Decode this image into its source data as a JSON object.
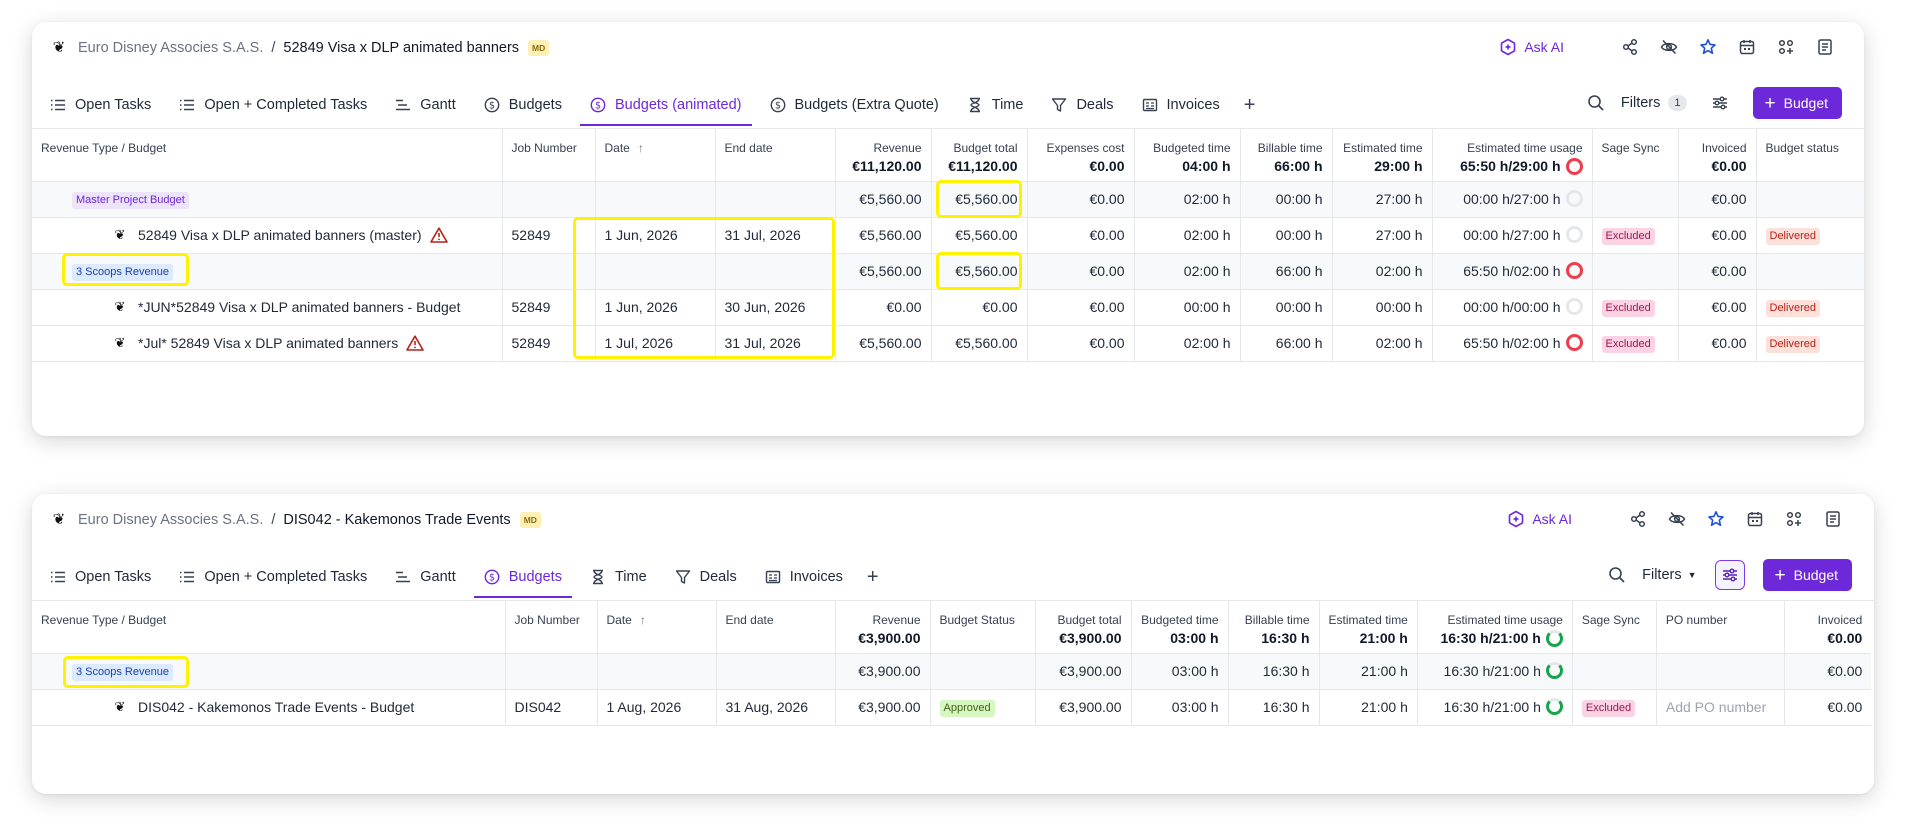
{
  "panel1": {
    "breadcrumb": {
      "client": "Euro Disney Associes S.A.S.",
      "separator": "/",
      "project": "52849 Visa x DLP animated banners",
      "badge": "MD"
    },
    "actions": {
      "ask_ai": "Ask AI",
      "icons": [
        "share-icon",
        "eye-off-icon",
        "star-icon",
        "calendar-icon",
        "apps-icon",
        "document-icon"
      ]
    },
    "tabs": [
      {
        "label": "Open Tasks",
        "icon": "list-icon",
        "active": false
      },
      {
        "label": "Open + Completed Tasks",
        "icon": "list-icon",
        "active": false
      },
      {
        "label": "Gantt",
        "icon": "gantt-icon",
        "active": false
      },
      {
        "label": "Budgets",
        "icon": "dollar-icon",
        "active": false
      },
      {
        "label": "Budgets (animated)",
        "icon": "dollar-icon",
        "active": true
      },
      {
        "label": "Budgets (Extra Quote)",
        "icon": "dollar-icon",
        "active": false
      },
      {
        "label": "Time",
        "icon": "hourglass-icon",
        "active": false
      },
      {
        "label": "Deals",
        "icon": "funnel-icon",
        "active": false
      },
      {
        "label": "Invoices",
        "icon": "invoice-icon",
        "active": false
      }
    ],
    "tools": {
      "filters_label": "Filters",
      "filters_count": "1",
      "budget_button": "Budget"
    },
    "columns": [
      {
        "label": "Revenue Type / Budget",
        "total": ""
      },
      {
        "label": "Job Number",
        "total": ""
      },
      {
        "label": "Date",
        "total": ""
      },
      {
        "label": "End date",
        "total": ""
      },
      {
        "label": "Revenue",
        "total": "€11,120.00"
      },
      {
        "label": "Budget total",
        "total": "€11,120.00"
      },
      {
        "label": "Expenses cost",
        "total": "€0.00"
      },
      {
        "label": "Budgeted time",
        "total": "04:00 h"
      },
      {
        "label": "Billable time",
        "total": "66:00 h"
      },
      {
        "label": "Estimated time",
        "total": "29:00 h"
      },
      {
        "label": "Estimated time usage",
        "total": "65:50 h/29:00 h"
      },
      {
        "label": "Sage Sync",
        "total": ""
      },
      {
        "label": "Invoiced",
        "total": "€0.00"
      },
      {
        "label": "Budget status",
        "total": ""
      }
    ],
    "header_ring": "red",
    "rows": [
      {
        "kind": "group",
        "name": "Master Project Budget",
        "pill": "purple",
        "job": "",
        "date": "",
        "end": "",
        "revenue": "€5,560.00",
        "budget_total": "€5,560.00",
        "expenses": "€0.00",
        "budgeted": "02:00 h",
        "billable": "00:00 h",
        "estimated": "27:00 h",
        "usage": "00:00 h/27:00 h",
        "ring": "grey",
        "sage": "",
        "invoiced": "€0.00",
        "status": ""
      },
      {
        "kind": "item",
        "name": "52849 Visa x DLP animated banners (master)",
        "warn": true,
        "job": "52849",
        "date": "1 Jun, 2026",
        "end": "31 Jul, 2026",
        "revenue": "€5,560.00",
        "budget_total": "€5,560.00",
        "expenses": "€0.00",
        "budgeted": "02:00 h",
        "billable": "00:00 h",
        "estimated": "27:00 h",
        "usage": "00:00 h/27:00 h",
        "ring": "grey",
        "sage": "Excluded",
        "invoiced": "€0.00",
        "status": "Delivered"
      },
      {
        "kind": "group",
        "name": "3 Scoops Revenue",
        "pill": "blue",
        "job": "",
        "date": "",
        "end": "",
        "revenue": "€5,560.00",
        "budget_total": "€5,560.00",
        "expenses": "€0.00",
        "budgeted": "02:00 h",
        "billable": "66:00 h",
        "estimated": "02:00 h",
        "usage": "65:50 h/02:00 h",
        "ring": "red",
        "sage": "",
        "invoiced": "€0.00",
        "status": ""
      },
      {
        "kind": "item",
        "name": "*JUN*52849 Visa x DLP animated banners - Budget",
        "warn": false,
        "job": "52849",
        "date": "1 Jun, 2026",
        "end": "30 Jun, 2026",
        "revenue": "€0.00",
        "budget_total": "€0.00",
        "expenses": "€0.00",
        "budgeted": "00:00 h",
        "billable": "00:00 h",
        "estimated": "00:00 h",
        "usage": "00:00 h/00:00 h",
        "ring": "grey",
        "sage": "Excluded",
        "invoiced": "€0.00",
        "status": "Delivered"
      },
      {
        "kind": "item",
        "name": "*Jul* 52849 Visa x DLP animated banners",
        "warn": true,
        "job": "52849",
        "date": "1 Jul, 2026",
        "end": "31 Jul, 2026",
        "revenue": "€5,560.00",
        "budget_total": "€5,560.00",
        "expenses": "€0.00",
        "budgeted": "02:00 h",
        "billable": "66:00 h",
        "estimated": "02:00 h",
        "usage": "65:50 h/02:00 h",
        "ring": "red",
        "sage": "Excluded",
        "invoiced": "€0.00",
        "status": "Delivered"
      }
    ]
  },
  "panel2": {
    "breadcrumb": {
      "client": "Euro Disney Associes S.A.S.",
      "separator": "/",
      "project": "DIS042 - Kakemonos Trade Events",
      "badge": "MD"
    },
    "actions": {
      "ask_ai": "Ask AI",
      "icons": [
        "share-icon",
        "eye-off-icon",
        "star-icon",
        "calendar-icon",
        "apps-icon",
        "document-icon"
      ]
    },
    "tabs": [
      {
        "label": "Open Tasks",
        "icon": "list-icon",
        "active": false
      },
      {
        "label": "Open + Completed Tasks",
        "icon": "list-icon",
        "active": false
      },
      {
        "label": "Gantt",
        "icon": "gantt-icon",
        "active": false
      },
      {
        "label": "Budgets",
        "icon": "dollar-icon",
        "active": true
      },
      {
        "label": "Time",
        "icon": "hourglass-icon",
        "active": false
      },
      {
        "label": "Deals",
        "icon": "funnel-icon",
        "active": false
      },
      {
        "label": "Invoices",
        "icon": "invoice-icon",
        "active": false
      }
    ],
    "tools": {
      "filters_label": "Filters",
      "budget_button": "Budget"
    },
    "columns": [
      {
        "label": "Revenue Type / Budget",
        "total": ""
      },
      {
        "label": "Job Number",
        "total": ""
      },
      {
        "label": "Date",
        "total": ""
      },
      {
        "label": "End date",
        "total": ""
      },
      {
        "label": "Revenue",
        "total": "€3,900.00"
      },
      {
        "label": "Budget Status",
        "total": ""
      },
      {
        "label": "Budget total",
        "total": "€3,900.00"
      },
      {
        "label": "Budgeted time",
        "total": "03:00 h"
      },
      {
        "label": "Billable time",
        "total": "16:30 h"
      },
      {
        "label": "Estimated time",
        "total": "21:00 h"
      },
      {
        "label": "Estimated time usage",
        "total": "16:30 h/21:00 h"
      },
      {
        "label": "Sage Sync",
        "total": ""
      },
      {
        "label": "PO number",
        "total": ""
      },
      {
        "label": "Invoiced",
        "total": "€0.00"
      }
    ],
    "header_ring": "green-part",
    "rows": [
      {
        "kind": "group",
        "name": "3 Scoops Revenue",
        "pill": "blue",
        "job": "",
        "date": "",
        "end": "",
        "revenue": "€3,900.00",
        "budget_status": "",
        "budget_total": "€3,900.00",
        "budgeted": "03:00 h",
        "billable": "16:30 h",
        "estimated": "21:00 h",
        "usage": "16:30 h/21:00 h",
        "ring": "green-part",
        "sage": "",
        "po": "",
        "invoiced": "€0.00"
      },
      {
        "kind": "item",
        "name": "DIS042 - Kakemonos Trade Events - Budget",
        "warn": false,
        "job": "DIS042",
        "date": "1 Aug, 2026",
        "end": "31 Aug, 2026",
        "revenue": "€3,900.00",
        "budget_status": "Approved",
        "budget_total": "€3,900.00",
        "budgeted": "03:00 h",
        "billable": "16:30 h",
        "estimated": "21:00 h",
        "usage": "16:30 h/21:00 h",
        "ring": "green-part",
        "sage": "Excluded",
        "po": "Add PO number",
        "invoiced": "€0.00"
      }
    ]
  }
}
